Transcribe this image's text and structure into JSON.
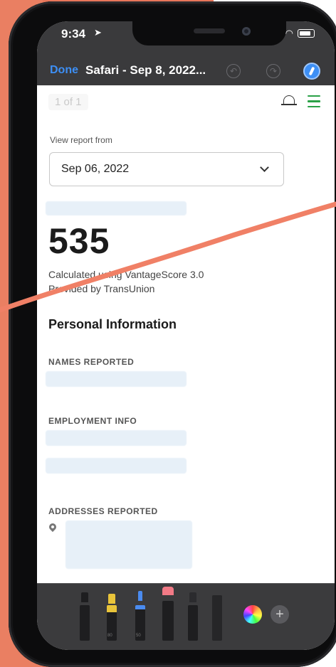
{
  "status_bar": {
    "time": "9:34",
    "location_icon": "location-arrow-icon"
  },
  "toolbar": {
    "done_label": "Done",
    "title": "Safari - Sep 8, 2022...",
    "undo_icon": "undo-icon",
    "redo_icon": "redo-icon",
    "markup_icon": "markup-pen-icon"
  },
  "page": {
    "page_count": "1 of 1",
    "view_report_label": "View report from",
    "selected_date": "Sep 06, 2022",
    "score": "535",
    "calculated_text": "Calculated using VantageScore 3.0",
    "provider_text": "Provided by TransUnion",
    "section_title": "Personal Information",
    "names_label": "NAMES REPORTED",
    "employment_label": "EMPLOYMENT INFO",
    "addresses_label": "ADDRESSES REPORTED"
  },
  "tools": {
    "add_label": "+",
    "marker_1_num": "80",
    "marker_2_num": "50"
  },
  "colors": {
    "accent_blue": "#3d8ff5",
    "menu_green": "#2aa147",
    "background_orange": "#e8765a",
    "markup_stroke": "#f08066"
  }
}
